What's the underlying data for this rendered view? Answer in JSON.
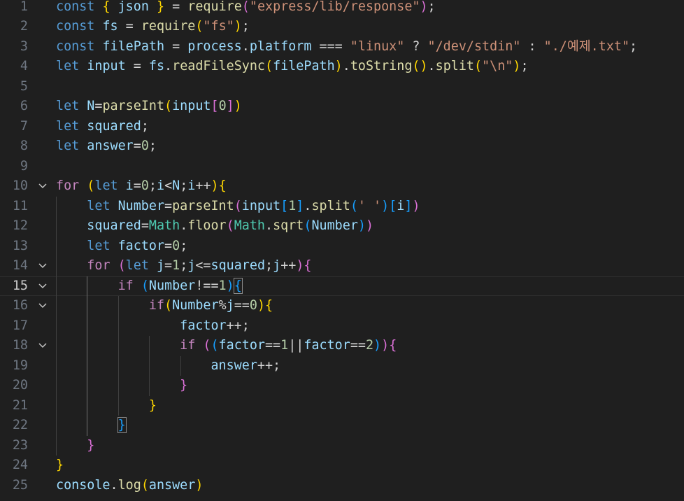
{
  "editor": {
    "active_line": 15,
    "lines": [
      {
        "n": "1",
        "tokens": [
          [
            "const",
            "t-kw"
          ],
          [
            " ",
            ""
          ],
          [
            "{",
            "t-b1"
          ],
          [
            " ",
            ""
          ],
          [
            "json",
            "t-var"
          ],
          [
            " ",
            ""
          ],
          [
            "}",
            "t-b1"
          ],
          [
            " = ",
            "t-op"
          ],
          [
            "require",
            "t-fn"
          ],
          [
            "(",
            "t-b2"
          ],
          [
            "\"express/lib/response\"",
            "t-str"
          ],
          [
            ")",
            "t-b2"
          ],
          [
            ";",
            "t-op"
          ]
        ]
      },
      {
        "n": "2",
        "tokens": [
          [
            "const",
            "t-kw"
          ],
          [
            " ",
            ""
          ],
          [
            "fs",
            "t-var"
          ],
          [
            " = ",
            "t-op"
          ],
          [
            "require",
            "t-fn"
          ],
          [
            "(",
            "t-b1"
          ],
          [
            "\"fs\"",
            "t-str"
          ],
          [
            ")",
            "t-b1"
          ],
          [
            ";",
            "t-op"
          ]
        ]
      },
      {
        "n": "3",
        "tokens": [
          [
            "const",
            "t-kw"
          ],
          [
            " ",
            ""
          ],
          [
            "filePath",
            "t-var"
          ],
          [
            " = ",
            "t-op"
          ],
          [
            "process",
            "t-var"
          ],
          [
            ".",
            "t-op"
          ],
          [
            "platform",
            "t-var"
          ],
          [
            " === ",
            "t-op"
          ],
          [
            "\"linux\"",
            "t-str"
          ],
          [
            " ? ",
            "t-op"
          ],
          [
            "\"/dev/stdin\"",
            "t-str"
          ],
          [
            " : ",
            "t-op"
          ],
          [
            "\"./예제.txt\"",
            "t-str"
          ],
          [
            ";",
            "t-op"
          ]
        ]
      },
      {
        "n": "4",
        "tokens": [
          [
            "let",
            "t-kw"
          ],
          [
            " ",
            ""
          ],
          [
            "input",
            "t-var"
          ],
          [
            " = ",
            "t-op"
          ],
          [
            "fs",
            "t-var"
          ],
          [
            ".",
            "t-op"
          ],
          [
            "readFileSync",
            "t-fn"
          ],
          [
            "(",
            "t-b1"
          ],
          [
            "filePath",
            "t-var"
          ],
          [
            ")",
            "t-b1"
          ],
          [
            ".",
            "t-op"
          ],
          [
            "toString",
            "t-fn"
          ],
          [
            "()",
            "t-b1"
          ],
          [
            ".",
            "t-op"
          ],
          [
            "split",
            "t-fn"
          ],
          [
            "(",
            "t-b1"
          ],
          [
            "\"\\n\"",
            "t-str"
          ],
          [
            ")",
            "t-b1"
          ],
          [
            ";",
            "t-op"
          ]
        ]
      },
      {
        "n": "5",
        "tokens": []
      },
      {
        "n": "6",
        "tokens": [
          [
            "let",
            "t-kw"
          ],
          [
            " ",
            ""
          ],
          [
            "N",
            "t-var"
          ],
          [
            "=",
            "t-op"
          ],
          [
            "parseInt",
            "t-fn"
          ],
          [
            "(",
            "t-b1"
          ],
          [
            "input",
            "t-var"
          ],
          [
            "[",
            "t-b2"
          ],
          [
            "0",
            "t-num"
          ],
          [
            "]",
            "t-b2"
          ],
          [
            ")",
            "t-b1"
          ]
        ]
      },
      {
        "n": "7",
        "tokens": [
          [
            "let",
            "t-kw"
          ],
          [
            " ",
            ""
          ],
          [
            "squared",
            "t-var"
          ],
          [
            ";",
            "t-op"
          ]
        ]
      },
      {
        "n": "8",
        "tokens": [
          [
            "let",
            "t-kw"
          ],
          [
            " ",
            ""
          ],
          [
            "answer",
            "t-var"
          ],
          [
            "=",
            "t-op"
          ],
          [
            "0",
            "t-num"
          ],
          [
            ";",
            "t-op"
          ]
        ]
      },
      {
        "n": "9",
        "tokens": []
      },
      {
        "n": "10",
        "fold": true,
        "tokens": [
          [
            "for",
            "t-ctl"
          ],
          [
            " ",
            ""
          ],
          [
            "(",
            "t-b1"
          ],
          [
            "let",
            "t-kw"
          ],
          [
            " ",
            ""
          ],
          [
            "i",
            "t-var"
          ],
          [
            "=",
            "t-op"
          ],
          [
            "0",
            "t-num"
          ],
          [
            ";",
            "t-op"
          ],
          [
            "i",
            "t-var"
          ],
          [
            "<",
            "t-op"
          ],
          [
            "N",
            "t-var"
          ],
          [
            ";",
            "t-op"
          ],
          [
            "i",
            "t-var"
          ],
          [
            "++",
            "t-op"
          ],
          [
            ")",
            "t-b1"
          ],
          [
            "{",
            "t-b1"
          ]
        ]
      },
      {
        "n": "11",
        "tokens": [
          [
            "    ",
            ""
          ],
          [
            "let",
            "t-kw"
          ],
          [
            " ",
            ""
          ],
          [
            "Number",
            "t-var"
          ],
          [
            "=",
            "t-op"
          ],
          [
            "parseInt",
            "t-fn"
          ],
          [
            "(",
            "t-b2"
          ],
          [
            "input",
            "t-var"
          ],
          [
            "[",
            "t-b3"
          ],
          [
            "1",
            "t-num"
          ],
          [
            "]",
            "t-b3"
          ],
          [
            ".",
            "t-op"
          ],
          [
            "split",
            "t-fn"
          ],
          [
            "(",
            "t-b3"
          ],
          [
            "' '",
            "t-str"
          ],
          [
            ")",
            "t-b3"
          ],
          [
            "[",
            "t-b3"
          ],
          [
            "i",
            "t-var"
          ],
          [
            "]",
            "t-b3"
          ],
          [
            ")",
            "t-b2"
          ]
        ]
      },
      {
        "n": "12",
        "tokens": [
          [
            "    ",
            ""
          ],
          [
            "squared",
            "t-var"
          ],
          [
            "=",
            "t-op"
          ],
          [
            "Math",
            "t-class"
          ],
          [
            ".",
            "t-op"
          ],
          [
            "floor",
            "t-fn"
          ],
          [
            "(",
            "t-b2"
          ],
          [
            "Math",
            "t-class"
          ],
          [
            ".",
            "t-op"
          ],
          [
            "sqrt",
            "t-fn"
          ],
          [
            "(",
            "t-b3"
          ],
          [
            "Number",
            "t-var"
          ],
          [
            ")",
            "t-b3"
          ],
          [
            ")",
            "t-b2"
          ]
        ]
      },
      {
        "n": "13",
        "tokens": [
          [
            "    ",
            ""
          ],
          [
            "let",
            "t-kw"
          ],
          [
            " ",
            ""
          ],
          [
            "factor",
            "t-var"
          ],
          [
            "=",
            "t-op"
          ],
          [
            "0",
            "t-num"
          ],
          [
            ";",
            "t-op"
          ]
        ]
      },
      {
        "n": "14",
        "fold": true,
        "tokens": [
          [
            "    ",
            ""
          ],
          [
            "for",
            "t-ctl"
          ],
          [
            " ",
            ""
          ],
          [
            "(",
            "t-b2"
          ],
          [
            "let",
            "t-kw"
          ],
          [
            " ",
            ""
          ],
          [
            "j",
            "t-var"
          ],
          [
            "=",
            "t-op"
          ],
          [
            "1",
            "t-num"
          ],
          [
            ";",
            "t-op"
          ],
          [
            "j",
            "t-var"
          ],
          [
            "<=",
            "t-op"
          ],
          [
            "squared",
            "t-var"
          ],
          [
            ";",
            "t-op"
          ],
          [
            "j",
            "t-var"
          ],
          [
            "++",
            "t-op"
          ],
          [
            ")",
            "t-b2"
          ],
          [
            "{",
            "t-b2"
          ]
        ]
      },
      {
        "n": "15",
        "fold": true,
        "tokens": [
          [
            "        ",
            ""
          ],
          [
            "if",
            "t-ctl"
          ],
          [
            " ",
            ""
          ],
          [
            "(",
            "t-b3"
          ],
          [
            "Number",
            "t-var"
          ],
          [
            "!==",
            "t-op"
          ],
          [
            "1",
            "t-num"
          ],
          [
            ")",
            "t-b3"
          ],
          [
            "{",
            "t-b3 match"
          ]
        ]
      },
      {
        "n": "16",
        "fold": true,
        "tokens": [
          [
            "            ",
            ""
          ],
          [
            "if",
            "t-ctl"
          ],
          [
            "(",
            "t-b1"
          ],
          [
            "Number",
            "t-var"
          ],
          [
            "%",
            "t-op"
          ],
          [
            "j",
            "t-var"
          ],
          [
            "==",
            "t-op"
          ],
          [
            "0",
            "t-num"
          ],
          [
            ")",
            "t-b1"
          ],
          [
            "{",
            "t-b1"
          ]
        ]
      },
      {
        "n": "17",
        "tokens": [
          [
            "                ",
            ""
          ],
          [
            "factor",
            "t-var"
          ],
          [
            "++;",
            "t-op"
          ]
        ]
      },
      {
        "n": "18",
        "fold": true,
        "tokens": [
          [
            "                ",
            ""
          ],
          [
            "if",
            "t-ctl"
          ],
          [
            " ",
            ""
          ],
          [
            "(",
            "t-b2"
          ],
          [
            "(",
            "t-b3"
          ],
          [
            "factor",
            "t-var"
          ],
          [
            "==",
            "t-op"
          ],
          [
            "1",
            "t-num"
          ],
          [
            "||",
            "t-op"
          ],
          [
            "factor",
            "t-var"
          ],
          [
            "==",
            "t-op"
          ],
          [
            "2",
            "t-num"
          ],
          [
            ")",
            "t-b3"
          ],
          [
            ")",
            "t-b2"
          ],
          [
            "{",
            "t-b2"
          ]
        ]
      },
      {
        "n": "19",
        "tokens": [
          [
            "                    ",
            ""
          ],
          [
            "answer",
            "t-var"
          ],
          [
            "++;",
            "t-op"
          ]
        ]
      },
      {
        "n": "20",
        "tokens": [
          [
            "                ",
            ""
          ],
          [
            "}",
            "t-b2"
          ]
        ]
      },
      {
        "n": "21",
        "tokens": [
          [
            "            ",
            ""
          ],
          [
            "}",
            "t-b1"
          ]
        ]
      },
      {
        "n": "22",
        "tokens": [
          [
            "        ",
            ""
          ],
          [
            "}",
            "t-b3 match"
          ]
        ]
      },
      {
        "n": "23",
        "tokens": [
          [
            "    ",
            ""
          ],
          [
            "}",
            "t-b2"
          ]
        ]
      },
      {
        "n": "24",
        "tokens": [
          [
            "}",
            "t-b1"
          ]
        ]
      },
      {
        "n": "25",
        "tokens": [
          [
            "console",
            "t-var"
          ],
          [
            ".",
            "t-op"
          ],
          [
            "log",
            "t-fn"
          ],
          [
            "(",
            "t-b1"
          ],
          [
            "answer",
            "t-var"
          ],
          [
            ")",
            "t-b1"
          ]
        ]
      }
    ]
  },
  "icons": {
    "fold": "chevron-down-icon"
  },
  "colors": {
    "background": "#1f1f1f",
    "keyword": "#569cd6",
    "control": "#c586c0",
    "variable": "#9cdcfe",
    "function": "#dcdcaa",
    "string": "#ce9178",
    "number": "#b5cea8",
    "bracket1": "#ffd700",
    "bracket2": "#da70d6",
    "bracket3": "#179fff"
  }
}
